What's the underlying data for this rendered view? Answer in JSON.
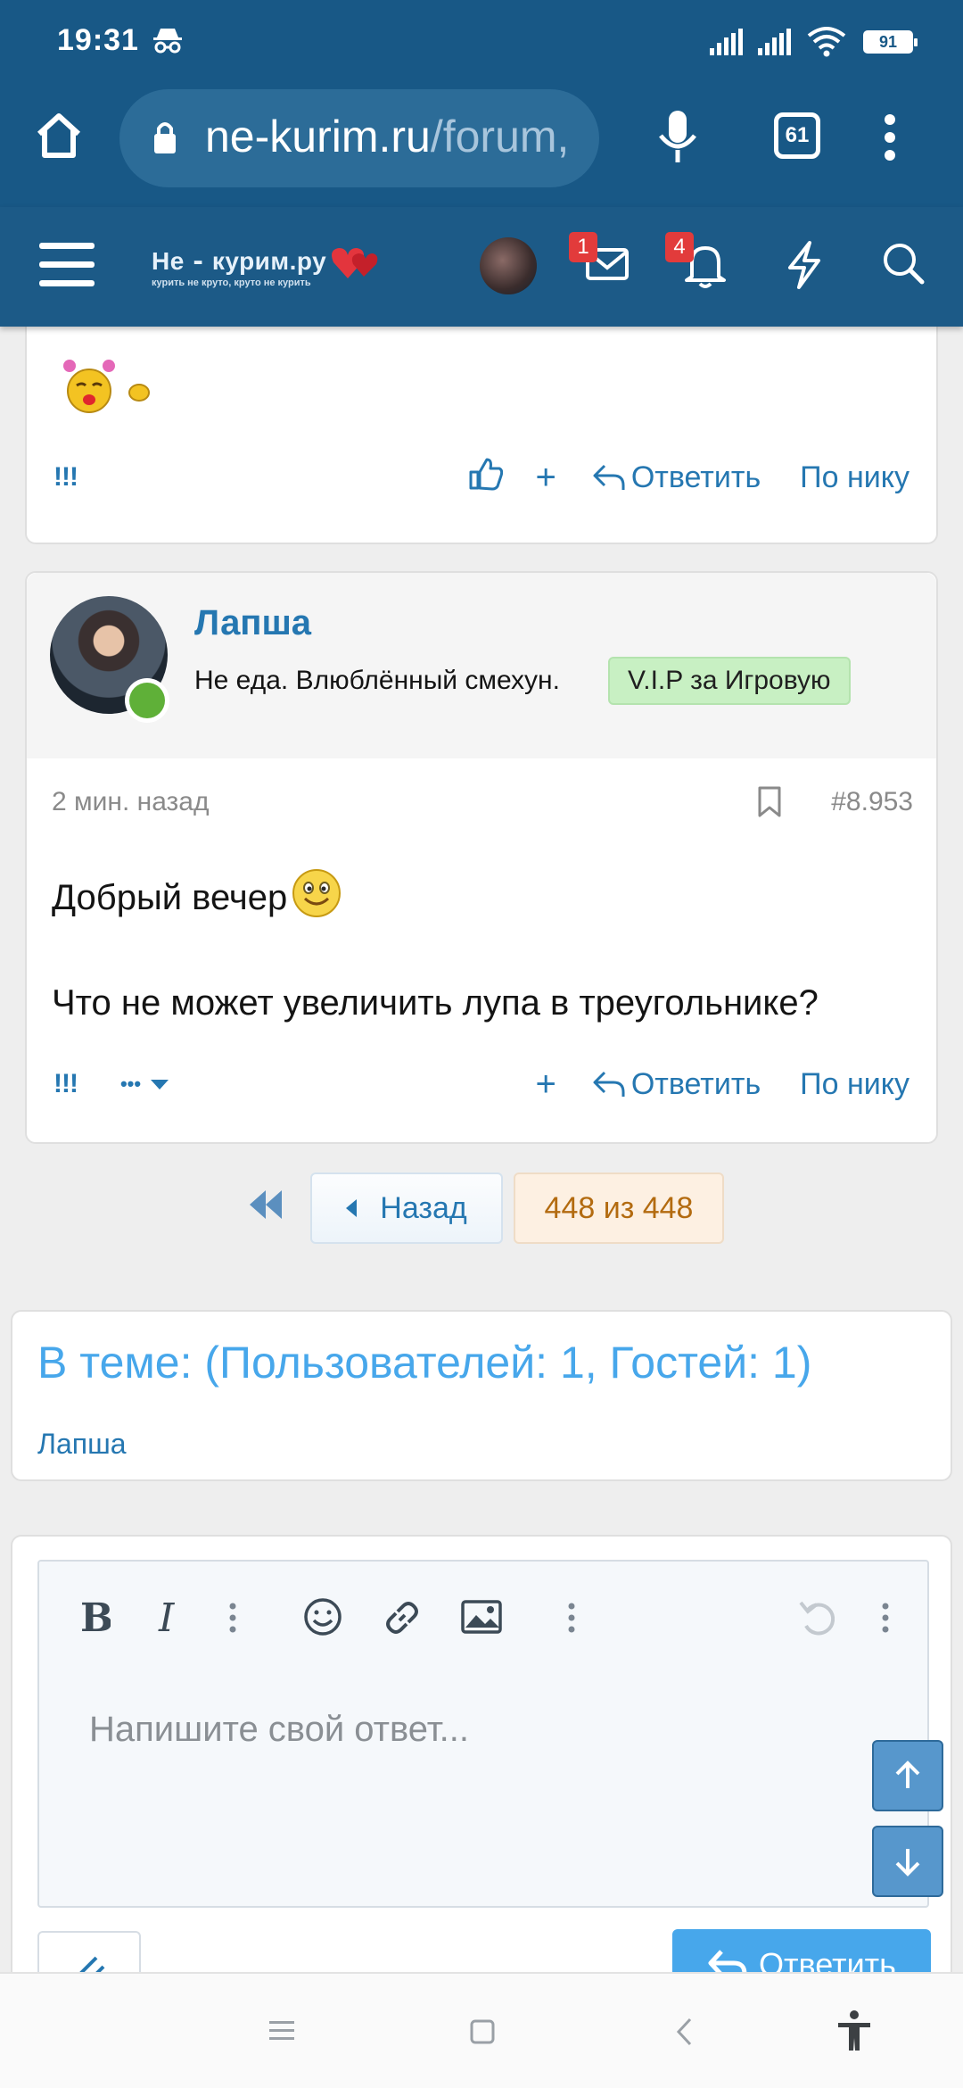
{
  "status_bar": {
    "time": "19:31",
    "battery": "91"
  },
  "browser": {
    "url_domain": "ne-kurim.ru",
    "url_path": "/forum,",
    "tab_count": "61"
  },
  "forum_header": {
    "logo_main": "Не ⁃ курим.ру",
    "logo_tagline": "курить не круто, круто не курить",
    "messages_badge": "1",
    "alerts_badge": "4"
  },
  "prev_post": {
    "actions": {
      "report": "!!!",
      "plus": "+",
      "reply": "Ответить",
      "by_nick": "По нику"
    }
  },
  "post": {
    "username": "Лапша",
    "user_title": "Не еда. Влюблённый смехун.",
    "badge": "V.I.P за Игровую",
    "time": "2 мин. назад",
    "number": "#8.953",
    "line1": "Добрый вечер",
    "line2": "Что не может увеличить лупа в треугольнике?",
    "actions": {
      "report": "!!!",
      "more": "•••",
      "plus": "+",
      "reply": "Ответить",
      "by_nick": "По нику"
    }
  },
  "pagination": {
    "back": "Назад",
    "current": "448 из 448"
  },
  "in_thread": {
    "title": "В теме: (Пользователей: 1, Гостей: 1)",
    "members": [
      "Лапша"
    ]
  },
  "editor": {
    "placeholder": "Напишите свой ответ...",
    "submit": "Ответить"
  },
  "colors": {
    "header": "#185886",
    "forum_header": "#1c5a87",
    "link": "#2577b1",
    "accent": "#47a7eb",
    "badge_green": "#c8f0c3",
    "notif_red": "#e23b3b"
  }
}
